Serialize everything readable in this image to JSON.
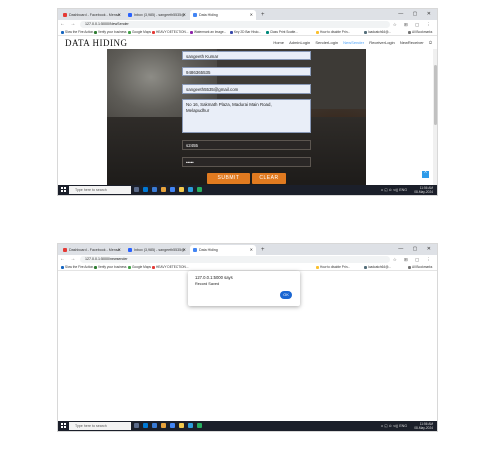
{
  "browser": {
    "tabs": [
      {
        "label": "Dashboard - Facebook - Mensa",
        "fav": "#e53935"
      },
      {
        "label": "Inbox (3,985) - sangeeth5535@",
        "fav": "#2962ff"
      },
      {
        "label": "Data Hiding",
        "fav": "#4285f4"
      }
    ],
    "new_tab": "+",
    "window_controls": "— ▢ ✕",
    "nav_buttons": "← → ⟳",
    "url": "127.0.0.1:5000/NewSender",
    "url_dialog": "127.0.0.1:5000/newsender",
    "addr_right": "☆ ⊞ ▢ ⋮",
    "bookmarks": [
      {
        "label": "Slow the Fire Action...",
        "color": "#1565c0"
      },
      {
        "label": "Verify your business",
        "color": "#2e7d32"
      },
      {
        "label": "Google Maps",
        "color": "#43a047"
      },
      {
        "label": "HEAVY DETECTION...",
        "color": "#e53935"
      },
      {
        "label": "Watermark an Image...",
        "color": "#8e24aa"
      },
      {
        "label": "Key 2D Bar Histo...",
        "color": "#3949ab"
      },
      {
        "label": "Class Print Scatte...",
        "color": "#00897b"
      },
      {
        "label": "How to disable Prin...",
        "color": "#fbc02d"
      },
      {
        "label": "loadcatch64@...",
        "color": "#546e7a"
      },
      {
        "label": "All Bookmarks",
        "color": "#757575"
      }
    ]
  },
  "site": {
    "logo": "DATA HIDING",
    "menu": [
      "Home",
      "AdminLogin",
      "SenderLogin",
      "NewSender",
      "ReceiverLogin",
      "NewReceiver"
    ],
    "active_menu": "NewSender",
    "logout_icon": "⏻"
  },
  "form": {
    "name": "sangeeth Kumar",
    "phone": "9486365535",
    "email": "sangeeth5535@gmail.com",
    "address": "No 16, Sakmath Plaza, Madurai Main Road,\nMelapudhur",
    "username": "s2455",
    "password": "•••••",
    "submit_label": "SUBMIT",
    "clear_label": "CLEAR"
  },
  "up_button": "^",
  "dialog": {
    "title": "127.0.0.1:5000 says",
    "message": "Record Saved",
    "ok_label": "OK"
  },
  "taskbar": {
    "search_placeholder": "Type here to search",
    "tray_icons": "∧ ◱ ⊙ ⊲)) ENG",
    "time": "11:56 AM",
    "date": "08-May-2024"
  }
}
